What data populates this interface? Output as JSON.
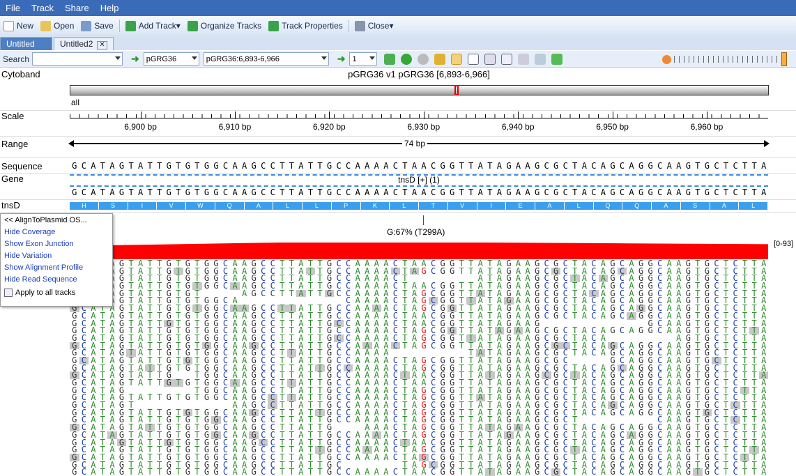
{
  "menu": [
    "File",
    "Track",
    "Share",
    "Help"
  ],
  "toolbar": {
    "new": "New",
    "open": "Open",
    "save": "Save",
    "add_track": "Add Track",
    "organize": "Organize Tracks",
    "properties": "Track Properties",
    "close": "Close"
  },
  "tabs": [
    "Untitled",
    "Untitled2"
  ],
  "nav": {
    "search_label": "Search",
    "search_value": "",
    "genome": "pGRG36",
    "location": "pGRG36:6,893-6,966",
    "frame": "1"
  },
  "tracks": {
    "cytoband": "Cytoband",
    "cyto_title": "pGRG36 v1 pGRG36 [6,893-6,966]",
    "cyto_all": "all",
    "scale": "Scale",
    "range": "Range",
    "range_text": "74 bp",
    "sequence": "Sequence",
    "gene": "Gene",
    "gene_name": "tnsD [+] (1)",
    "tnsd": "tnsD"
  },
  "scale_ticks": [
    "6,900 bp",
    "6,910 bp",
    "6,920 bp",
    "6,930 bp",
    "6,940 bp",
    "6,950 bp",
    "6,960 bp"
  ],
  "sequence": "GCATAGTATTGTGTGGCAAGCCTTATTGCCAAAACTAACGGTTATAGAAGCGCTACAGCAGGCAAGTGCTCTTA",
  "amino": [
    "H",
    "S",
    "I",
    "V",
    "W",
    "Q",
    "A",
    "L",
    "L",
    "P",
    "K",
    "L",
    "T",
    "V",
    "I",
    "E",
    "A",
    "L",
    "Q",
    "Q",
    "A",
    "S",
    "A",
    "L"
  ],
  "variant_label": "G:67% (T299A)",
  "coverage_range": "[0-93]",
  "popup": {
    "title": "<< AlignToPlasmid OS...",
    "items": [
      "Hide Coverage",
      "Show Exon Junction",
      "Hide Variation",
      "Show Alignment Profile",
      "Hide Read Sequence"
    ],
    "apply": "Apply to all tracks"
  },
  "colors": {
    "A": "#2e8b2e",
    "C": "#1f3fa0",
    "G": "#3a3a3a",
    "T": "#2e8b2e"
  }
}
